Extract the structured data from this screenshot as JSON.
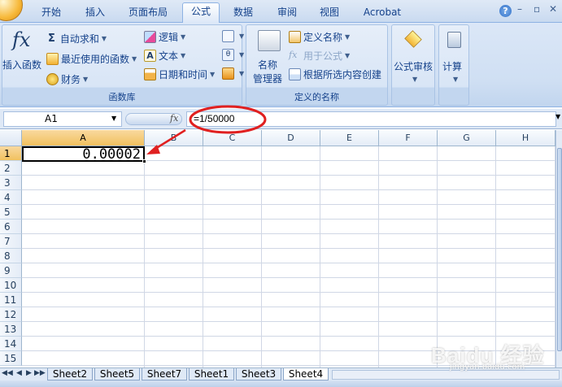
{
  "tabs": [
    {
      "label": "开始"
    },
    {
      "label": "插入"
    },
    {
      "label": "页面布局"
    },
    {
      "label": "公式"
    },
    {
      "label": "数据"
    },
    {
      "label": "审阅"
    },
    {
      "label": "视图"
    },
    {
      "label": "Acrobat"
    }
  ],
  "active_tab": "公式",
  "ribbon": {
    "function_library": {
      "insert_function": "插入函数",
      "autosum": "自动求和",
      "recently_used": "最近使用的函数",
      "financial": "财务",
      "logical": "逻辑",
      "text": "文本",
      "date_time": "日期和时间",
      "group_label": "函数库"
    },
    "defined_names": {
      "name_manager": "名称",
      "name_manager_2": "管理器",
      "define_name": "定义名称",
      "use_in_formula": "用于公式",
      "create_from_selection": "根据所选内容创建",
      "group_label": "定义的名称"
    },
    "formula_auditing": {
      "label": "公式审核"
    },
    "calculation": {
      "label": "计算"
    }
  },
  "formula_bar": {
    "name_box": "A1",
    "fx": "fx",
    "formula": "=1/50000"
  },
  "columns": [
    "A",
    "B",
    "C",
    "D",
    "E",
    "F",
    "G",
    "H"
  ],
  "rows": [
    "1",
    "2",
    "3",
    "4",
    "5",
    "6",
    "7",
    "8",
    "9",
    "10",
    "11",
    "12",
    "13",
    "14",
    "15"
  ],
  "active_cell": {
    "ref": "A1",
    "value": "0.00002"
  },
  "sheets": [
    {
      "name": "Sheet2"
    },
    {
      "name": "Sheet5"
    },
    {
      "name": "Sheet7"
    },
    {
      "name": "Sheet1"
    },
    {
      "name": "Sheet3"
    },
    {
      "name": "Sheet4"
    }
  ],
  "active_sheet": "Sheet4",
  "annotation_color": "#e02020",
  "watermark": "Baidu 经验",
  "watermark_sub": "jingyan.baidu.com"
}
